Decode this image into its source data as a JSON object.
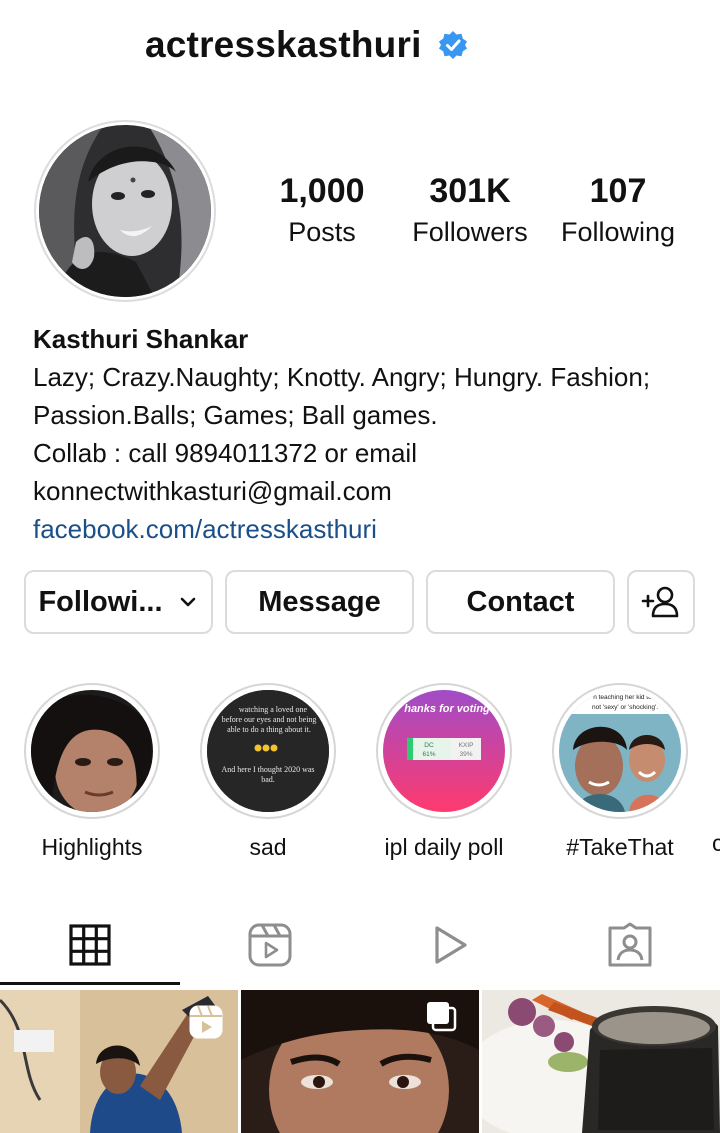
{
  "profile": {
    "username": "actresskasthuri",
    "verified": true,
    "display_name": "Kasthuri Shankar",
    "bio_lines": [
      "Lazy; Crazy.Naughty; Knotty. Angry; Hungry. Fashion;",
      "Passion.Balls; Games; Ball games.",
      "Collab : call 9894011372 or email",
      "konnectwithkasturi@gmail.com"
    ],
    "link": "facebook.com/actresskasthuri"
  },
  "stats": {
    "posts": {
      "value": "1,000",
      "label": "Posts"
    },
    "followers": {
      "value": "301K",
      "label": "Followers"
    },
    "following": {
      "value": "107",
      "label": "Following"
    }
  },
  "actions": {
    "following_label": "Followi...",
    "message_label": "Message",
    "contact_label": "Contact",
    "add_user_icon": "add-person-icon"
  },
  "highlights": [
    {
      "label": "Highlights"
    },
    {
      "label": "sad",
      "texts": [
        "watching a loved one",
        "before our eyes and not being",
        "able to do a thing about it.",
        "And here I thought 2020 was",
        "bad."
      ]
    },
    {
      "label": "ipl daily poll",
      "texts": [
        "hanks for voting",
        "DC",
        "61%",
        "KXIP",
        "39%"
      ]
    },
    {
      "label": "#TakeThat",
      "texts": [
        "n teaching her kid to s",
        "not 'sexy' or 'shocking'."
      ]
    }
  ],
  "tabs": [
    "grid-icon",
    "reels-icon",
    "play-icon",
    "tagged-icon"
  ],
  "colors": {
    "verified": "#3897f0",
    "link": "#1b4f8a",
    "border": "#dbdbdb"
  }
}
